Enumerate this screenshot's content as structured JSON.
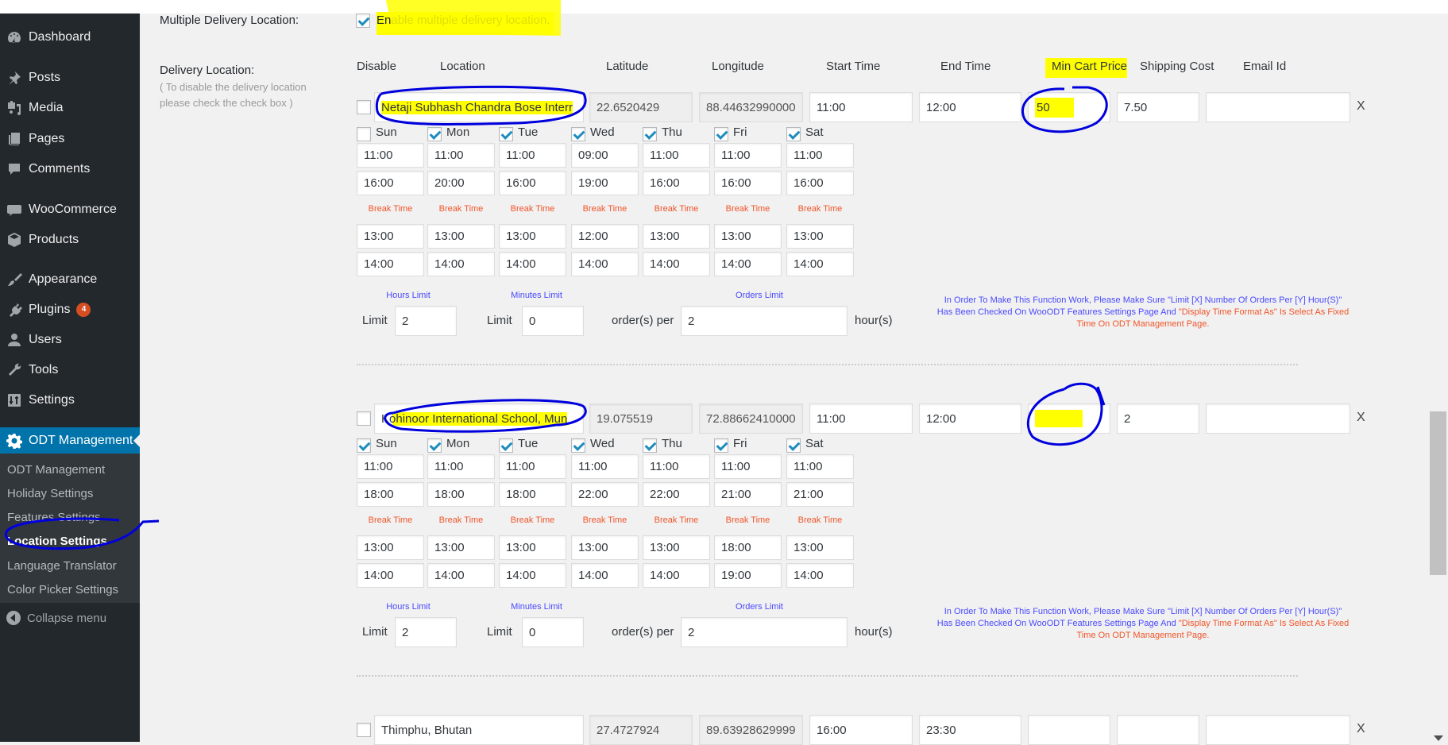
{
  "sidebar": {
    "items": [
      {
        "label": "Dashboard",
        "icon": "dashboard-icon"
      },
      {
        "label": "Posts",
        "icon": "pin-icon"
      },
      {
        "label": "Media",
        "icon": "media-icon"
      },
      {
        "label": "Pages",
        "icon": "pages-icon"
      },
      {
        "label": "Comments",
        "icon": "comment-icon"
      },
      {
        "label": "WooCommerce",
        "icon": "woo-icon"
      },
      {
        "label": "Products",
        "icon": "box-icon"
      },
      {
        "label": "Appearance",
        "icon": "brush-icon"
      },
      {
        "label": "Plugins",
        "icon": "plug-icon",
        "badge": "4"
      },
      {
        "label": "Users",
        "icon": "user-icon"
      },
      {
        "label": "Tools",
        "icon": "wrench-icon"
      },
      {
        "label": "Settings",
        "icon": "sliders-icon"
      },
      {
        "label": "ODT Management",
        "icon": "gear-icon",
        "active": true
      }
    ],
    "submenu": [
      {
        "label": "ODT Management"
      },
      {
        "label": "Holiday Settings"
      },
      {
        "label": "Features Settings"
      },
      {
        "label": "Location Settings",
        "current": true
      },
      {
        "label": "Language Translator"
      },
      {
        "label": "Color Picker Settings"
      }
    ],
    "collapse_label": "Collapse menu"
  },
  "form": {
    "multiple_label": "Multiple Delivery Location:",
    "multiple_checkbox_label": "Enable multiple delivery location.",
    "multiple_enabled": true,
    "delivery_label": "Delivery Location:",
    "delivery_desc_1": "( To disable the delivery location",
    "delivery_desc_2": "please check the check box )",
    "headers": {
      "disable": "Disable",
      "location": "Location",
      "latitude": "Latitude",
      "longitude": "Longitude",
      "start_time": "Start Time",
      "end_time": "End Time",
      "min_cart_price": "Min Cart Price",
      "shipping_cost": "Shipping Cost",
      "email_id": "Email Id"
    },
    "days": [
      "Sun",
      "Mon",
      "Tue",
      "Wed",
      "Thu",
      "Fri",
      "Sat"
    ],
    "break_label": "Break Time",
    "hours_limit_caption": "Hours Limit",
    "minutes_limit_caption": "Minutes Limit",
    "orders_limit_caption": "Orders Limit",
    "limit_label": "Limit",
    "orders_per_label": "order(s) per",
    "hours_label": "hour(s)",
    "note_blue": "In Order To Make This Function Work, Please Make Sure \"Limit [X] Number Of Orders Per [Y] Hour(S)\" Has Been Checked On WooODT Features Settings Page And ",
    "note_red": "\"Display Time Format As\" Is Select As Fixed Time On ODT Management Page.",
    "remove_label": "X",
    "locations": [
      {
        "disabled": false,
        "location": "Netaji Subhash Chandra Bose Interr",
        "latitude": "22.6520429",
        "longitude": "88.44632990000",
        "start_time": "11:00",
        "end_time": "12:00",
        "min_cart_price": "50",
        "shipping_cost": "7.50",
        "email_id": "",
        "day_checked": [
          false,
          true,
          true,
          true,
          true,
          true,
          true
        ],
        "open": [
          "11:00",
          "11:00",
          "11:00",
          "09:00",
          "11:00",
          "11:00",
          "11:00"
        ],
        "close": [
          "16:00",
          "20:00",
          "16:00",
          "19:00",
          "16:00",
          "16:00",
          "16:00"
        ],
        "break_start": [
          "13:00",
          "13:00",
          "13:00",
          "12:00",
          "13:00",
          "13:00",
          "13:00"
        ],
        "break_end": [
          "14:00",
          "14:00",
          "14:00",
          "14:00",
          "14:00",
          "14:00",
          "14:00"
        ],
        "hours_limit": "2",
        "minutes_limit": "0",
        "orders_limit": "2"
      },
      {
        "disabled": false,
        "location": "Kohinoor International School, Mun",
        "latitude": "19.075519",
        "longitude": "72.88662410000",
        "start_time": "11:00",
        "end_time": "12:00",
        "min_cart_price": "",
        "shipping_cost": "2",
        "email_id": "",
        "day_checked": [
          true,
          true,
          true,
          true,
          true,
          true,
          true
        ],
        "open": [
          "11:00",
          "11:00",
          "11:00",
          "11:00",
          "11:00",
          "11:00",
          "11:00"
        ],
        "close": [
          "18:00",
          "18:00",
          "18:00",
          "22:00",
          "22:00",
          "21:00",
          "21:00"
        ],
        "break_start": [
          "13:00",
          "13:00",
          "13:00",
          "13:00",
          "13:00",
          "18:00",
          "13:00"
        ],
        "break_end": [
          "14:00",
          "14:00",
          "14:00",
          "14:00",
          "14:00",
          "19:00",
          "14:00"
        ],
        "hours_limit": "2",
        "minutes_limit": "0",
        "orders_limit": "2"
      },
      {
        "disabled": false,
        "location": "Thimphu, Bhutan",
        "latitude": "27.4727924",
        "longitude": "89.63928629999",
        "start_time": "16:00",
        "end_time": "23:30",
        "min_cart_price": "",
        "shipping_cost": "",
        "email_id": ""
      }
    ]
  },
  "colors": {
    "sidebar_bg": "#23282d",
    "active_menu": "#0073aa",
    "break_label": "#f0552a",
    "limit_caption": "#4a4aff",
    "highlight": "#ffff00",
    "annotation_ink": "#0000dd"
  }
}
